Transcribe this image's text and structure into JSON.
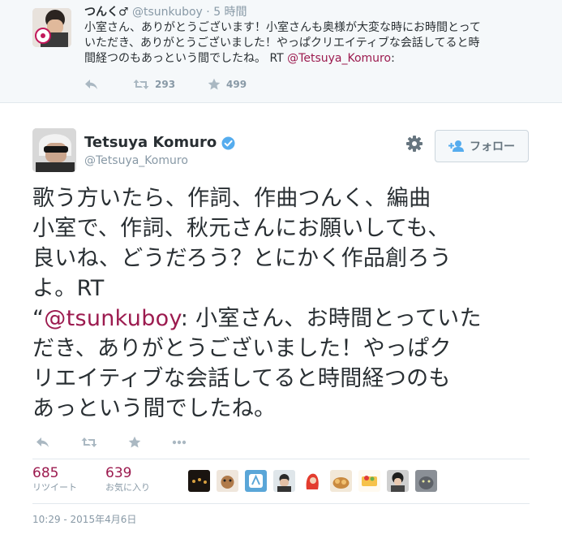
{
  "parent_tweet": {
    "name": "つんく♂",
    "handle": "@tsunkuboy",
    "separator": "·",
    "time": "5 時間",
    "text_lines": [
      "小室さん、ありがとうございます！小室さんも奥様が大変な時にお時間とって",
      "いただき、ありがとうございました！やっぱクリエイティブな会話してると時",
      "間経つのもあっという間でしたね。 RT "
    ],
    "mention": "@Tetsuya_Komuro",
    "mention_suffix": ":",
    "retweet_count": "293",
    "favorite_count": "499",
    "icons": [
      "reply-icon",
      "retweet-icon",
      "star-icon"
    ]
  },
  "main_tweet": {
    "name": "Tetsuya Komuro",
    "handle": "@Tetsuya_Komuro",
    "follow_label": "フォロー",
    "lines": [
      "歌う方いたら、作詞、作曲つんく、編曲",
      "小室で、作詞、秋元さんにお願いしても、",
      "良いね、どうだろう？とにかく作品創ろう",
      "よ。RT"
    ],
    "quote_open": "“",
    "quote_mention": "@tsunkuboy",
    "quote_line1_rest": ": 小室さん、お時間とっていた",
    "quote_lines": [
      "だき、ありがとうございました！やっぱク",
      "リエイティブな会話してると時間経つのも",
      "あっという間でしたね。"
    ],
    "retweets_num": "685",
    "retweets_label": "リツイート",
    "favorites_num": "639",
    "favorites_label": "お気に入り",
    "timestamp": "10:29 - 2015年4月6日",
    "accent_color": "#9c1b4f",
    "verified_color": "#55acee"
  }
}
